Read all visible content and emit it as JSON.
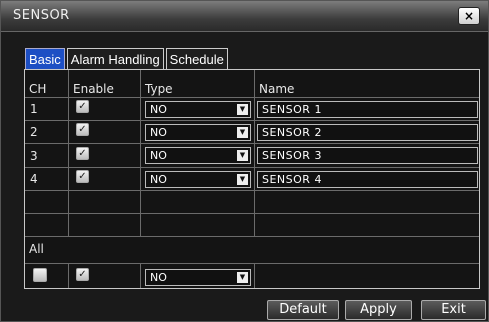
{
  "window": {
    "title": "SENSOR",
    "close_label": "×"
  },
  "tabs": [
    {
      "label": "Basic",
      "active": true
    },
    {
      "label": "Alarm Handling",
      "active": false
    },
    {
      "label": "Schedule",
      "active": false
    }
  ],
  "table": {
    "headers": {
      "ch": "CH",
      "enable": "Enable",
      "type": "Type",
      "name": "Name"
    },
    "rows": [
      {
        "ch": "1",
        "enabled": true,
        "type": "NO",
        "name": "SENSOR 1"
      },
      {
        "ch": "2",
        "enabled": true,
        "type": "NO",
        "name": "SENSOR 2"
      },
      {
        "ch": "3",
        "enabled": true,
        "type": "NO",
        "name": "SENSOR 3"
      },
      {
        "ch": "4",
        "enabled": true,
        "type": "NO",
        "name": "SENSOR 4"
      }
    ]
  },
  "all_row": {
    "label": "All",
    "select_checked": false,
    "enabled": true,
    "type": "NO"
  },
  "buttons": {
    "default": "Default",
    "apply": "Apply",
    "exit": "Exit"
  },
  "colors": {
    "active_tab": "#1d4fc4",
    "background": "#1a1a1a"
  },
  "icons": {
    "checkbox_check": "✓",
    "dropdown_arrow": "▼"
  }
}
